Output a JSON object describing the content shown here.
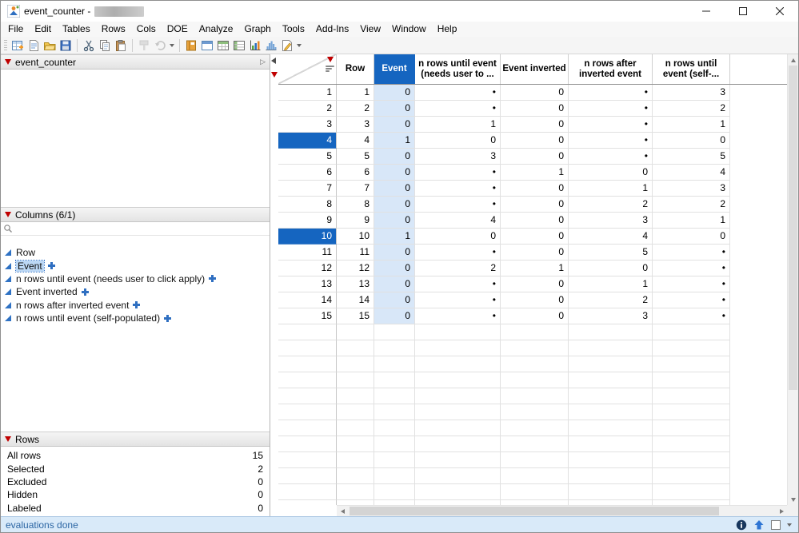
{
  "titlebar": {
    "title": "event_counter -"
  },
  "menu": {
    "items": [
      "File",
      "Edit",
      "Tables",
      "Rows",
      "Cols",
      "DOE",
      "Analyze",
      "Graph",
      "Tools",
      "Add-Ins",
      "View",
      "Window",
      "Help"
    ]
  },
  "toolbar": {
    "icons": [
      "new-data-table",
      "new-script",
      "open",
      "save",
      "cut",
      "copy",
      "paste",
      "format-painter",
      "clear",
      "overflow-chevron",
      "journal",
      "new-window",
      "summary",
      "subset",
      "graph-builder",
      "distribution",
      "script",
      "overflow-chevron"
    ]
  },
  "sidebar": {
    "table_panel": {
      "title": "event_counter"
    },
    "columns_panel": {
      "title": "Columns (6/1)",
      "items": [
        {
          "label": "Row",
          "formula": false,
          "selected": false
        },
        {
          "label": "Event",
          "formula": true,
          "selected": true
        },
        {
          "label": "n rows until event (needs user to click apply)",
          "formula": true,
          "selected": false
        },
        {
          "label": "Event inverted",
          "formula": true,
          "selected": false
        },
        {
          "label": "n rows after inverted event",
          "formula": true,
          "selected": false
        },
        {
          "label": "n rows until event (self-populated)",
          "formula": true,
          "selected": false
        }
      ]
    },
    "rows_panel": {
      "title": "Rows",
      "stats": [
        {
          "label": "All rows",
          "value": "15"
        },
        {
          "label": "Selected",
          "value": "2"
        },
        {
          "label": "Excluded",
          "value": "0"
        },
        {
          "label": "Hidden",
          "value": "0"
        },
        {
          "label": "Labeled",
          "value": "0"
        }
      ]
    }
  },
  "table": {
    "columns": [
      {
        "label": "Row"
      },
      {
        "label": "Event",
        "selected": true
      },
      {
        "label": "n rows until event\n(needs user to ..."
      },
      {
        "label": "Event inverted"
      },
      {
        "label": "n rows after\ninverted event"
      },
      {
        "label": "n rows until\nevent (self-..."
      }
    ],
    "selected_rows": [
      4,
      10
    ],
    "rows": [
      {
        "n": 1,
        "cells": [
          "1",
          "0",
          "•",
          "0",
          "•",
          "3"
        ]
      },
      {
        "n": 2,
        "cells": [
          "2",
          "0",
          "•",
          "0",
          "•",
          "2"
        ]
      },
      {
        "n": 3,
        "cells": [
          "3",
          "0",
          "1",
          "0",
          "•",
          "1"
        ]
      },
      {
        "n": 4,
        "cells": [
          "4",
          "1",
          "0",
          "0",
          "•",
          "0"
        ]
      },
      {
        "n": 5,
        "cells": [
          "5",
          "0",
          "3",
          "0",
          "•",
          "5"
        ]
      },
      {
        "n": 6,
        "cells": [
          "6",
          "0",
          "•",
          "1",
          "0",
          "4"
        ]
      },
      {
        "n": 7,
        "cells": [
          "7",
          "0",
          "•",
          "0",
          "1",
          "3"
        ]
      },
      {
        "n": 8,
        "cells": [
          "8",
          "0",
          "•",
          "0",
          "2",
          "2"
        ]
      },
      {
        "n": 9,
        "cells": [
          "9",
          "0",
          "4",
          "0",
          "3",
          "1"
        ]
      },
      {
        "n": 10,
        "cells": [
          "10",
          "1",
          "0",
          "0",
          "4",
          "0"
        ]
      },
      {
        "n": 11,
        "cells": [
          "11",
          "0",
          "•",
          "0",
          "5",
          "•"
        ]
      },
      {
        "n": 12,
        "cells": [
          "12",
          "0",
          "2",
          "1",
          "0",
          "•"
        ]
      },
      {
        "n": 13,
        "cells": [
          "13",
          "0",
          "•",
          "0",
          "1",
          "•"
        ]
      },
      {
        "n": 14,
        "cells": [
          "14",
          "0",
          "•",
          "0",
          "2",
          "•"
        ]
      },
      {
        "n": 15,
        "cells": [
          "15",
          "0",
          "•",
          "0",
          "3",
          "•"
        ]
      }
    ]
  },
  "status": {
    "text": "evaluations done"
  }
}
